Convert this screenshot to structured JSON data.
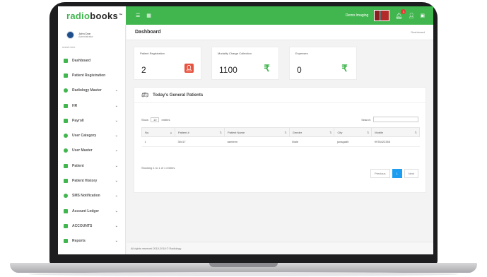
{
  "app": {
    "brand_part1": "radio",
    "brand_part2": "books",
    "brand_tm": "™"
  },
  "topbar": {
    "user_label": "Demo Imaging",
    "notification_count": "1"
  },
  "sidebar": {
    "profile_name": "John Doe",
    "profile_role": "Administrator",
    "search_placeholder": "search here",
    "items": [
      {
        "label": "Dashboard"
      },
      {
        "label": "Patient Registration"
      },
      {
        "label": "Radiology Master"
      },
      {
        "label": "HR"
      },
      {
        "label": "Payroll"
      },
      {
        "label": "User Category"
      },
      {
        "label": "User Master"
      },
      {
        "label": "Patient"
      },
      {
        "label": "Patient History"
      },
      {
        "label": "SMS Notification"
      },
      {
        "label": "Account Ledger"
      },
      {
        "label": "ACCOUNTS"
      },
      {
        "label": "Reports"
      }
    ]
  },
  "header": {
    "title": "Dashboard",
    "breadcrumb": "Dashboard"
  },
  "stats": [
    {
      "label": "Patient Registration",
      "value": "2",
      "icon": "user-icon"
    },
    {
      "label": "Modality Charge Collection",
      "value": "1100",
      "icon": "rupee-icon"
    },
    {
      "label": "Expenses",
      "value": "0",
      "icon": "rupee-icon"
    }
  ],
  "panel": {
    "title": "Today's General Patients",
    "show_label": "Show",
    "show_value": "10",
    "entries_label": "entries",
    "search_label": "Search:"
  },
  "table": {
    "headers": [
      "No.",
      "Patient #",
      "Patient Name",
      "Gender",
      "City",
      "Mobile"
    ],
    "rows": [
      [
        "1",
        "30417",
        "ramteen",
        "Male",
        "junagadh",
        "9978422355"
      ]
    ],
    "info": "Showing 1 to 1 of 1 entries",
    "prev": "Previous",
    "page": "1",
    "next": "Next"
  },
  "footer": {
    "text": "All rights reserved 2015-2018 © Radiology"
  },
  "colors": {
    "accent": "#41b64f",
    "pager_active": "#1e9ef0",
    "user_icon_bg": "#e8533f"
  }
}
